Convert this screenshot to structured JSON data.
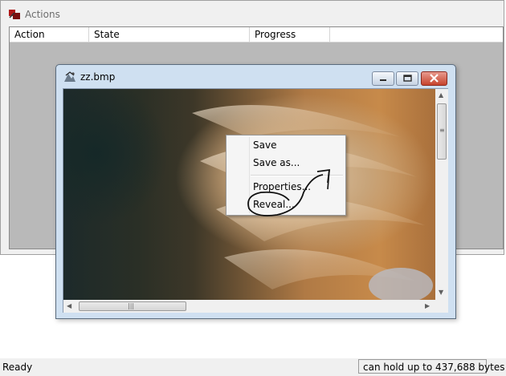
{
  "actions_panel": {
    "title": "Actions",
    "columns": [
      "Action",
      "State",
      "Progress"
    ]
  },
  "image_window": {
    "title": "zz.bmp"
  },
  "context_menu": {
    "items": [
      "Save",
      "Save as...",
      "Properties...",
      "Reveal..."
    ]
  },
  "status_bar": {
    "status": "Ready",
    "capacity": "can hold up to 437,688 bytes"
  },
  "icons": {
    "actions": "actions-app-icon",
    "window": "bitmap-file-icon",
    "minimize": "minimize-icon",
    "maximize": "maximize-icon",
    "close": "close-icon"
  },
  "colors": {
    "close_button": "#c6432d",
    "title_bar": "#cfe0f1",
    "table_background": "#b9b9b9"
  }
}
